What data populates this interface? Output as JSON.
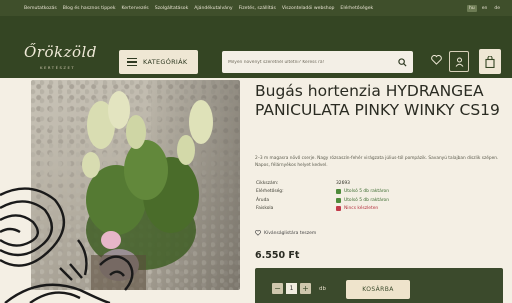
{
  "topbar": {
    "links": [
      "Bemutatkozás",
      "Blog és hasznos tippek",
      "Kertervezés",
      "Szolgáltatások",
      "Ajándékutalvány",
      "Fizetés, szállítás",
      "Viszonteladói webshop",
      "Elérhetőségek"
    ],
    "languages": [
      {
        "code": "hu",
        "active": true
      },
      {
        "code": "en",
        "active": false
      },
      {
        "code": "de",
        "active": false
      }
    ]
  },
  "header": {
    "logo": "Őrökzöld",
    "logo_sub": "KERTÉSZET",
    "categories_label": "KATEGÓRIÁK",
    "search_placeholder": "Milyen növényt szeretnél ültetni? Keress rá!"
  },
  "product": {
    "title": "Bugás hortenzia HYDRANGEA PANICULATA PINKY WINKY CS19",
    "description": "2–3 m magasra növő cserje. Nagy rózsaszín-fehér virágzata július-tól pompázik. Savanyú talajban díszlik szépen. Napos, félárnyékos helyet kedvel.",
    "specs": [
      {
        "label": "Cikkszám:",
        "value": "32693",
        "status": "none"
      },
      {
        "label": "Elérhetőség:",
        "value": "Utolsó 5 db raktáron",
        "status": "green"
      },
      {
        "label": "Áruda",
        "value": "Utolsó 5 db raktáron",
        "status": "green"
      },
      {
        "label": "Faiskola",
        "value": "Nincs készleten",
        "status": "red"
      }
    ],
    "wishlist_label": "Kívánságlistára teszem",
    "price": "6.550 Ft"
  },
  "cart": {
    "minus": "−",
    "quantity": "1",
    "plus": "+",
    "unit": "db",
    "add_label": "KOSÁRBA"
  },
  "colors": {
    "topbar": "#3f4f2b",
    "header": "#344523",
    "background": "#f4efe4",
    "green_status": "#4e8a3a",
    "red_status": "#c23a4a"
  }
}
